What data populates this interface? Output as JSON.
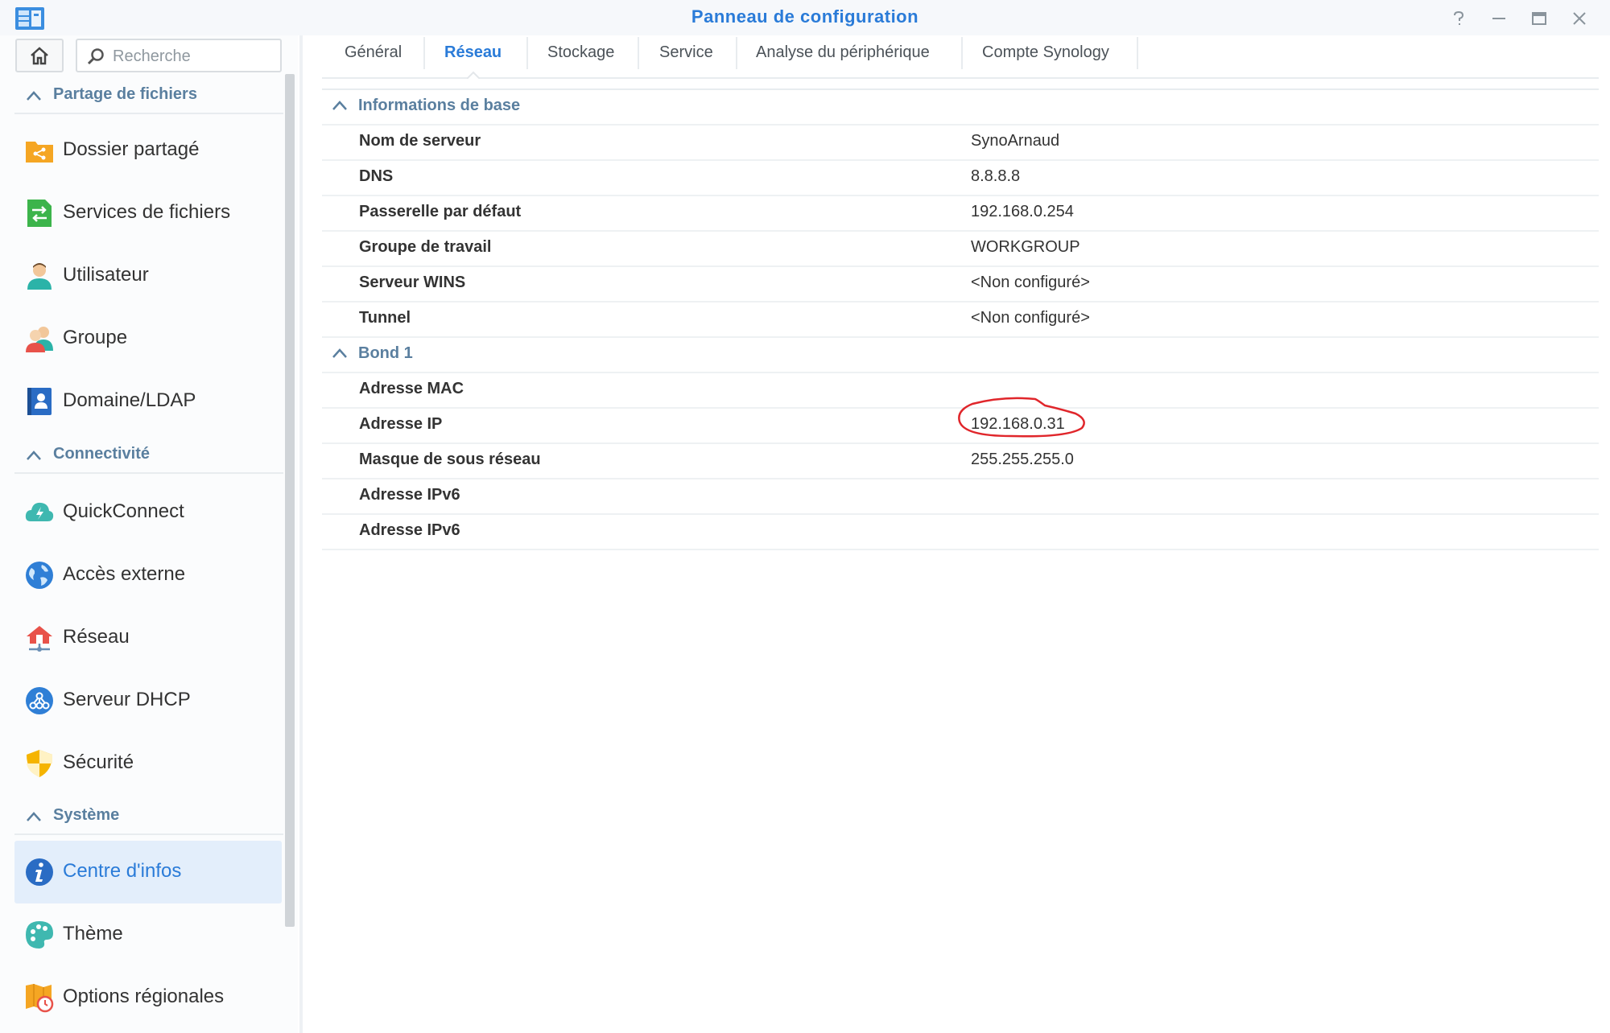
{
  "window": {
    "title": "Panneau de configuration",
    "accent": "#2a7bd8"
  },
  "sidebar": {
    "search_placeholder": "Recherche",
    "sections": {
      "file_sharing": "Partage de fichiers",
      "connectivity": "Connectivité",
      "system": "Système"
    },
    "items": {
      "shared_folder": "Dossier partagé",
      "file_services": "Services de fichiers",
      "user": "Utilisateur",
      "group": "Groupe",
      "domain_ldap": "Domaine/LDAP",
      "quickconnect": "QuickConnect",
      "external_access": "Accès externe",
      "network": "Réseau",
      "dhcp_server": "Serveur DHCP",
      "security": "Sécurité",
      "info_center": "Centre d'infos",
      "theme": "Thème",
      "regional_options": "Options régionales"
    },
    "active_item": "info_center"
  },
  "tabs": {
    "general": "Général",
    "network": "Réseau",
    "storage": "Stockage",
    "service": "Service",
    "device_analysis": "Analyse du périphérique",
    "synology_account": "Compte Synology",
    "active": "network"
  },
  "basic_info": {
    "title": "Informations de base",
    "server_name_label": "Nom de serveur",
    "server_name": "SynoArnaud",
    "dns_label": "DNS",
    "dns": "8.8.8.8",
    "gateway_label": "Passerelle par défaut",
    "gateway": "192.168.0.254",
    "workgroup_label": "Groupe de travail",
    "workgroup": "WORKGROUP",
    "wins_label": "Serveur WINS",
    "wins": "<Non configuré>",
    "tunnel_label": "Tunnel",
    "tunnel": "<Non configuré>"
  },
  "bond": {
    "title": "Bond 1",
    "mac_label": "Adresse MAC",
    "mac": "",
    "ip_label": "Adresse IP",
    "ip": "192.168.0.31",
    "mask_label": "Masque de sous réseau",
    "mask": "255.255.255.0",
    "ipv6_label_1": "Adresse IPv6",
    "ipv6_1": "",
    "ipv6_label_2": "Adresse IPv6",
    "ipv6_2": ""
  },
  "icons": {
    "app": "control-panel-icon",
    "help": "help-icon",
    "minimize": "minimize-icon",
    "maximize": "maximize-icon",
    "close": "close-icon",
    "home": "home-icon",
    "search": "search-icon"
  },
  "annotation_color": "#e0262b"
}
